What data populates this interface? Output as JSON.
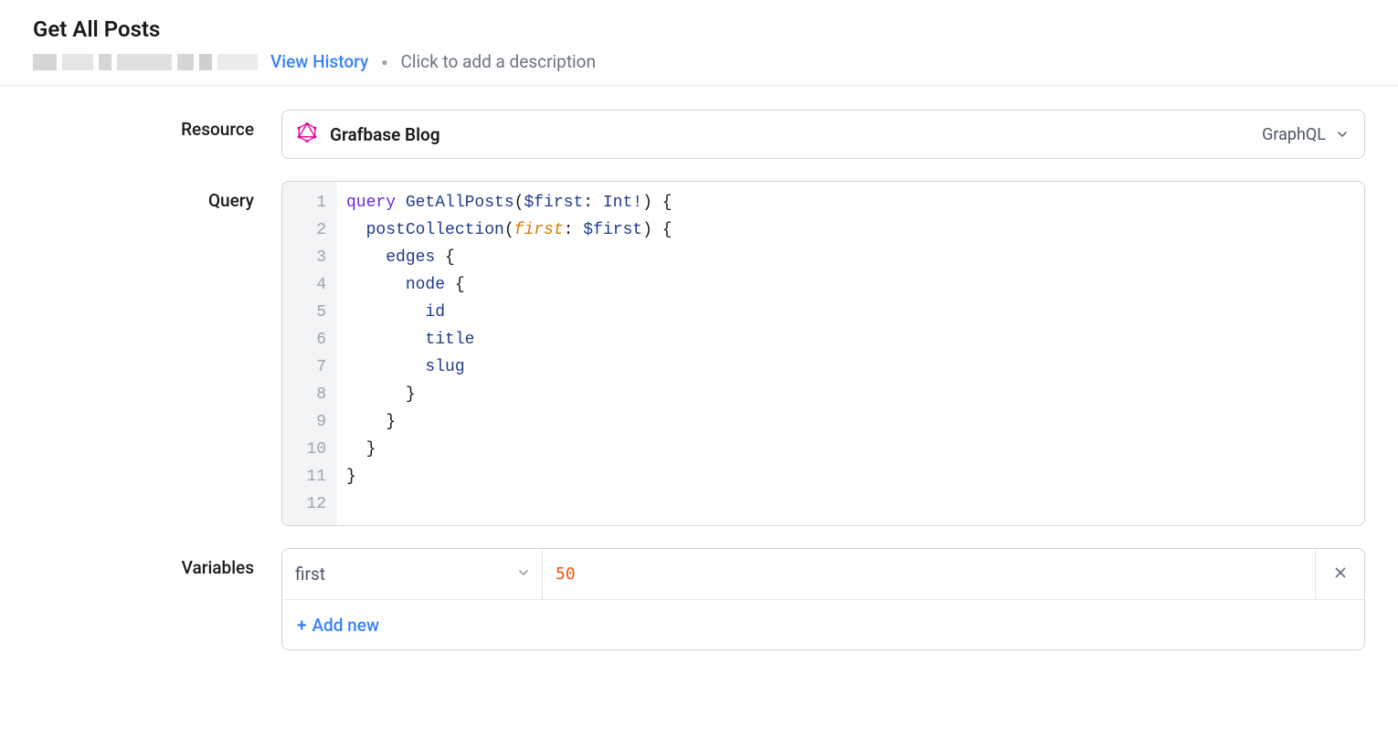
{
  "header": {
    "title": "Get All Posts",
    "view_history": "View History",
    "description_placeholder": "Click to add a description"
  },
  "labels": {
    "resource": "Resource",
    "query": "Query",
    "variables": "Variables"
  },
  "resource": {
    "name": "Grafbase Blog",
    "type": "GraphQL"
  },
  "query": {
    "line_count": 12,
    "tokens": {
      "kw_query": "query",
      "op_name": " GetAllPosts",
      "var_decl": "$first",
      "type_int": "Int!",
      "field_postCollection": "postCollection",
      "arg_first": "first",
      "var_ref": "$first",
      "field_edges": "edges",
      "field_node": "node",
      "field_id": "id",
      "field_title": "title",
      "field_slug": "slug"
    }
  },
  "variables": {
    "rows": [
      {
        "key": "first",
        "value": "50"
      }
    ],
    "add_new": "Add new"
  }
}
